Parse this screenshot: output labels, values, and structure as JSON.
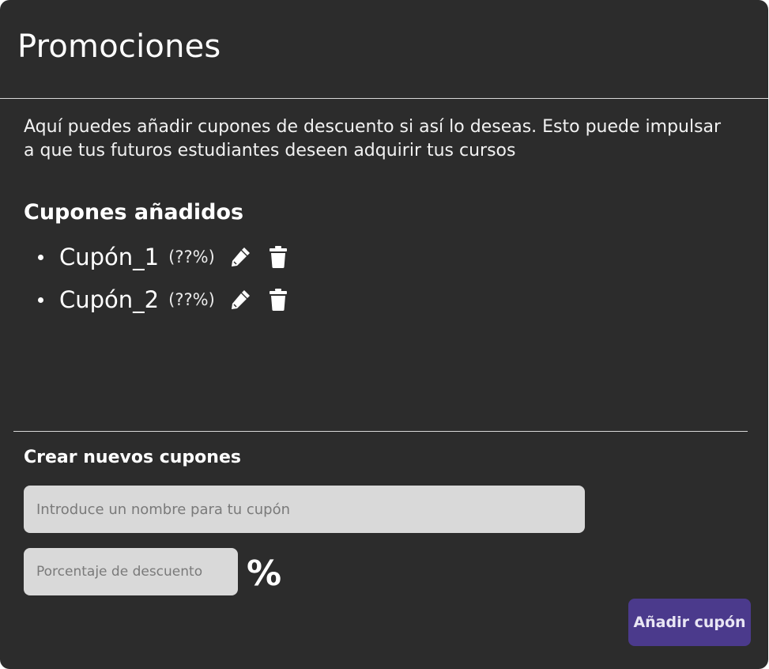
{
  "page": {
    "title": "Promociones",
    "intro": "Aquí puedes añadir cupones de descuento si así lo deseas. Esto puede impulsar a que tus futuros estudiantes deseen adquirir tus cursos"
  },
  "coupons_section": {
    "title": "Cupones añadidos",
    "items": [
      {
        "name": "Cupón_1",
        "percent": "(??%)",
        "edit_icon": "pencil-icon",
        "delete_icon": "trash-icon"
      },
      {
        "name": "Cupón_2",
        "percent": "(??%)",
        "edit_icon": "pencil-icon",
        "delete_icon": "trash-icon"
      }
    ]
  },
  "create_section": {
    "title": "Crear nuevos cupones",
    "name_input": {
      "placeholder": "Introduce un nombre para tu cupón",
      "value": ""
    },
    "percent_input": {
      "placeholder": "Porcentaje de descuento",
      "value": ""
    },
    "percent_symbol": "%",
    "add_button_label": "Añadir cupón"
  },
  "colors": {
    "panel_background": "#2c2c2c",
    "input_background": "#d9d9d9",
    "accent_button": "#4b3a8c",
    "text": "#ffffff"
  }
}
